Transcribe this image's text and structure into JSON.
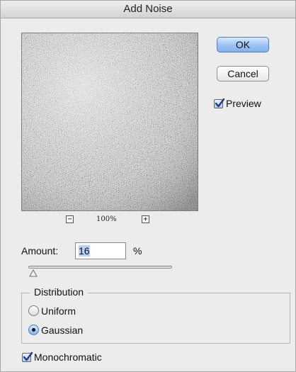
{
  "window": {
    "title": "Add Noise"
  },
  "preview": {
    "zoom_out_icon": "minus-icon",
    "zoom_in_icon": "plus-icon",
    "zoom_label": "100%"
  },
  "buttons": {
    "ok": "OK",
    "cancel": "Cancel"
  },
  "preview_toggle": {
    "label": "Preview",
    "checked": true
  },
  "amount": {
    "label": "Amount:",
    "value": "16",
    "unit": "%",
    "slider_value": 16,
    "slider_max": 400
  },
  "distribution": {
    "legend": "Distribution",
    "options": [
      {
        "label": "Uniform",
        "selected": false
      },
      {
        "label": "Gaussian",
        "selected": true
      }
    ]
  },
  "monochromatic": {
    "label": "Monochromatic",
    "checked": true
  },
  "colors": {
    "default_button": "#9ac2f1",
    "selection": "#b5d3ff",
    "check": "#1f3c88"
  }
}
